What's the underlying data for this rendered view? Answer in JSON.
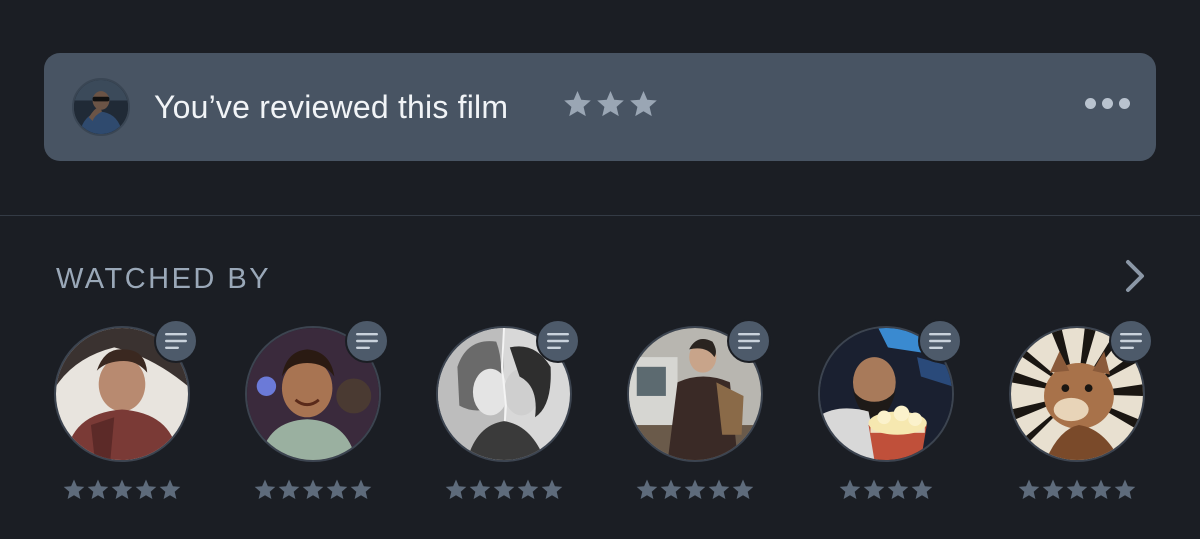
{
  "review": {
    "text": "You’ve reviewed this film",
    "rating": 3,
    "star_color": "#9aa6b4"
  },
  "watched_by": {
    "title": "WATCHED BY",
    "friends": [
      {
        "rating": 5
      },
      {
        "rating": 5
      },
      {
        "rating": 5
      },
      {
        "rating": 5
      },
      {
        "rating": 4
      },
      {
        "rating": 5
      }
    ]
  },
  "colors": {
    "background": "#1b1e24",
    "card": "#485463",
    "friend_star": "#5e6b7b",
    "badge": "#4d5a6a"
  }
}
